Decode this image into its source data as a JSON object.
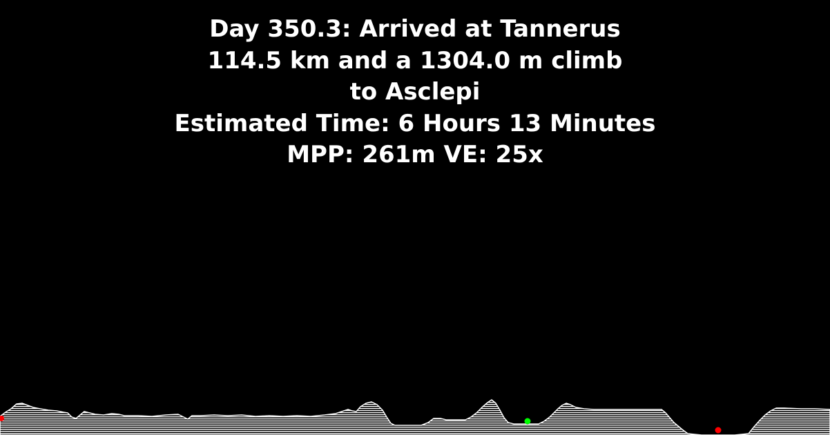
{
  "info": {
    "line1": "Day 350.3: Arrived at Tannerus",
    "line2": "114.5 km and a 1304.0 m climb",
    "line3": "to Asclepi",
    "line4": "Estimated Time: 6 Hours 13 Minutes",
    "line5": "MPP: 261m VE: 25x"
  },
  "colors": {
    "background": "#000000",
    "text": "#ffffff",
    "terrain": "#ffffff",
    "marker_current": "#00ff00",
    "marker_city": "#ff0000"
  },
  "markers": [
    {
      "name": "start-marker",
      "color": "marker_city"
    },
    {
      "name": "current-position-marker",
      "color": "marker_current"
    },
    {
      "name": "destination-marker",
      "color": "marker_city"
    }
  ]
}
